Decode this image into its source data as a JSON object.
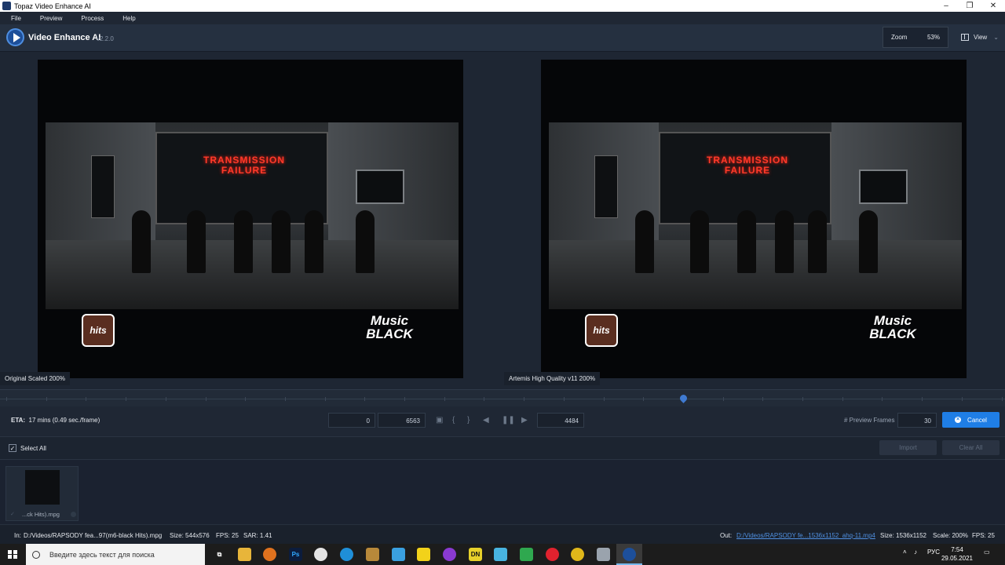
{
  "window": {
    "title": "Topaz Video Enhance AI",
    "minimize": "–",
    "maximize": "❐",
    "close": "✕"
  },
  "menu": [
    "File",
    "Preview",
    "Process",
    "Help"
  ],
  "header": {
    "app_name": "Video Enhance AI",
    "version": "v2.2.0",
    "zoom_label": "Zoom",
    "zoom_value": "53%",
    "view_label": "View"
  },
  "preview": {
    "scene_text_line1": "TRANSMISSION",
    "scene_text_line2": "FAILURE",
    "hits_logo": "hits",
    "music_black_logo_line1": "Music",
    "music_black_logo_line2": "BLACK",
    "left_caption": "Original Scaled 200%",
    "right_caption": "Artemis High Quality v11 200%"
  },
  "timeline": {
    "position_fraction": 0.68
  },
  "controls": {
    "eta_label": "ETA:",
    "eta_value": "17 mins  (0.49 sec./frame)",
    "start_frame": "0",
    "end_frame": "6563",
    "current_frame": "4484",
    "preview_frames_label": "# Preview Frames",
    "preview_frames_value": "30",
    "cancel_label": "Cancel"
  },
  "selection": {
    "select_all_label": "Select All",
    "import_label": "Import",
    "clear_all_label": "Clear All"
  },
  "files": [
    {
      "name": "...ck Hits).mpg"
    }
  ],
  "status": {
    "in_label": "In:",
    "in_path": "D:/Videos/RAPSODY fea...97(m6-black Hits).mpg",
    "in_size": "Size: 544x576",
    "in_fps": "FPS: 25",
    "in_sar": "SAR: 1.41",
    "out_label": "Out:",
    "out_path": "D:/Videos/RAPSODY fe...1536x1152_ahq-11.mp4",
    "out_size": "Size: 1536x1152",
    "out_scale": "Scale: 200%",
    "out_fps": "FPS: 25"
  },
  "taskbar": {
    "search_placeholder": "Введите здесь текст для поиска",
    "language": "РУС",
    "time": "7:54",
    "date": "29.05.2021"
  },
  "colors": {
    "accent": "#1f7ee6",
    "background": "#1b2330",
    "link": "#4f8fe0"
  }
}
